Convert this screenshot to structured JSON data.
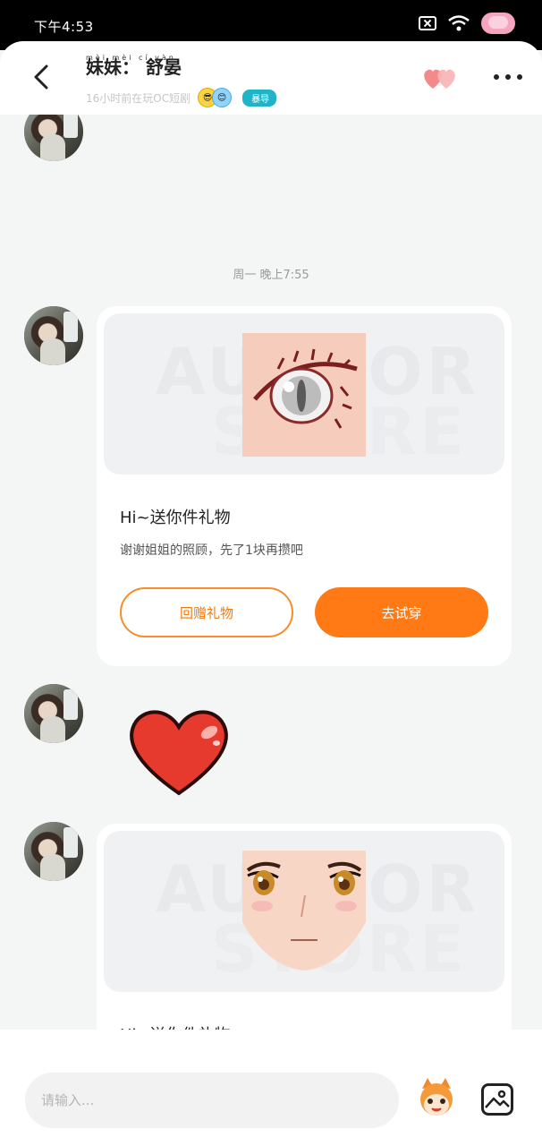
{
  "status_bar": {
    "time": "下午4:53"
  },
  "header": {
    "title": "妹妹：  舒晏",
    "title_pinyin": "mèi mèi      cí yàn",
    "status": "16小时前在玩OC短剧",
    "badge": "暴导",
    "icons": [
      "back-arrow-icon",
      "hearts-icon",
      "more-icon"
    ]
  },
  "chat": {
    "timestamp": "周一 晚上7:55",
    "messages": [
      {
        "type": "gift_card",
        "title": "Hi~送你件礼物",
        "subtitle": "谢谢姐姐的照顾，先了1块再攒吧",
        "watermark": "AUTHOR",
        "watermark2": "STORE",
        "reply_label": "回赠礼物",
        "try_label": "去试穿"
      },
      {
        "type": "sticker",
        "icon": "red-heart-sticker"
      },
      {
        "type": "gift_card",
        "title": "Hi~送你件礼物",
        "watermark": "AUTHOR",
        "watermark2": "STORE"
      }
    ]
  },
  "input": {
    "placeholder": "请输入..."
  },
  "colors": {
    "accent": "#ff7a14",
    "outline": "#f58d2a",
    "background": "#f4f5f5"
  }
}
